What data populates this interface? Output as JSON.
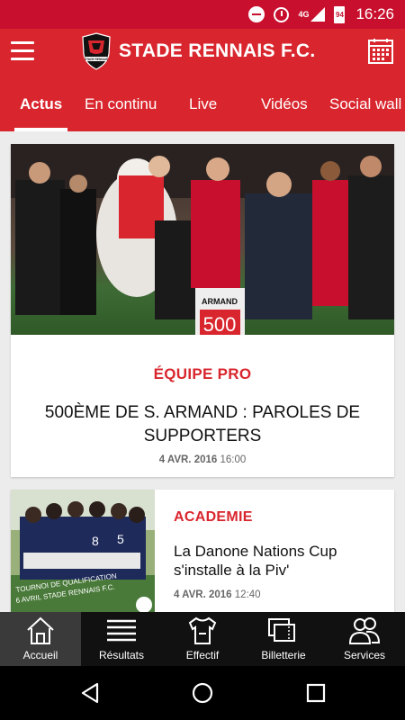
{
  "status_bar": {
    "network_label": "4G",
    "battery_level": "94",
    "time": "16:26",
    "icons": [
      "do-not-disturb-icon",
      "alarm-icon",
      "signal-icon",
      "battery-icon"
    ]
  },
  "header": {
    "title": "STADE RENNAIS F.C.",
    "logo_text": "STADE RENNAIS",
    "menu_icon": "hamburger-menu-icon",
    "calendar_icon": "calendar-icon"
  },
  "tabs": [
    {
      "label": "Actus",
      "active": true
    },
    {
      "label": "En continu",
      "active": false
    },
    {
      "label": "Live",
      "active": false
    },
    {
      "label": "Vidéos",
      "active": false
    },
    {
      "label": "Social wall",
      "active": false
    }
  ],
  "articles": [
    {
      "category": "ÉQUIPE PRO",
      "title": "500ÈME DE S. ARMAND : PAROLES DE SUPPORTERS",
      "date": "4 AVR. 2016",
      "time": "16:00",
      "image_text": [
        "ARMAND",
        "500"
      ]
    },
    {
      "category": "ACADEMIE",
      "title": "La Danone Nations Cup s'installe à la Piv'",
      "date": "4 AVR. 2016",
      "time": "12:40",
      "image_text": [
        "TOURNOI DE QUALIFICATION",
        "6 AVRIL STADE RENNAIS F.C."
      ]
    }
  ],
  "bottom_nav": [
    {
      "label": "Accueil",
      "icon": "home-icon",
      "active": true
    },
    {
      "label": "Résultats",
      "icon": "results-list-icon",
      "active": false
    },
    {
      "label": "Effectif",
      "icon": "jersey-icon",
      "active": false
    },
    {
      "label": "Billetterie",
      "icon": "tickets-icon",
      "active": false
    },
    {
      "label": "Services",
      "icon": "services-people-icon",
      "active": false
    }
  ],
  "colors": {
    "primary": "#d9262e",
    "status_bar": "#c8102e",
    "bottom_nav": "#111111",
    "accent_text": "#d9262e"
  }
}
